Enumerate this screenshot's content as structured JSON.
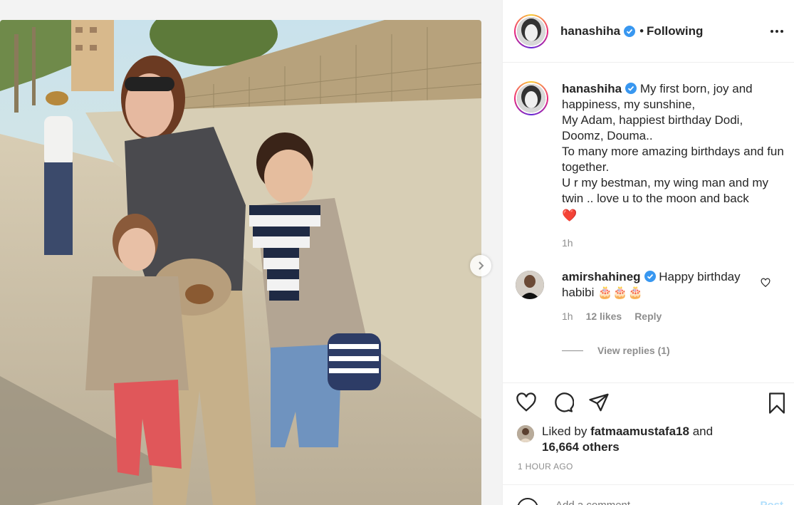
{
  "post": {
    "username": "hanashiha",
    "dot": "•",
    "following_label": "Following"
  },
  "caption": {
    "username": "hanashiha",
    "text": "My first born, joy and happiness, my sunshine,\nMy Adam, happiest birthday Dodi, Doomz, Douma..\nTo many more amazing birthdays and fun together.\nU r my bestman, my wing man and my twin .. love u to the moon and back",
    "emoji": "❤️",
    "time": "1h"
  },
  "comment": {
    "username": "amirshahineg",
    "text": "Happy birthday habibi",
    "emoji": "🎂🎂🎂",
    "time": "1h",
    "likes": "12 likes",
    "reply_label": "Reply",
    "view_replies": "View replies (1)"
  },
  "likes": {
    "prefix": "Liked by",
    "user": "fatmaamustafa18",
    "and": "and",
    "others": "16,664 others"
  },
  "post_time": "1 HOUR AGO",
  "add_comment": {
    "placeholder": "Add a comment…",
    "post_label": "Post"
  },
  "colors": {
    "verified": "#3897f0",
    "heart_red": "#ed4956",
    "text_secondary": "#8e8e8e"
  },
  "icons": [
    "verified-icon",
    "more-options-icon",
    "like-heart-icon",
    "comment-icon",
    "share-icon",
    "save-icon",
    "comment-like-icon",
    "next-arrow-icon",
    "emoji-icon"
  ]
}
